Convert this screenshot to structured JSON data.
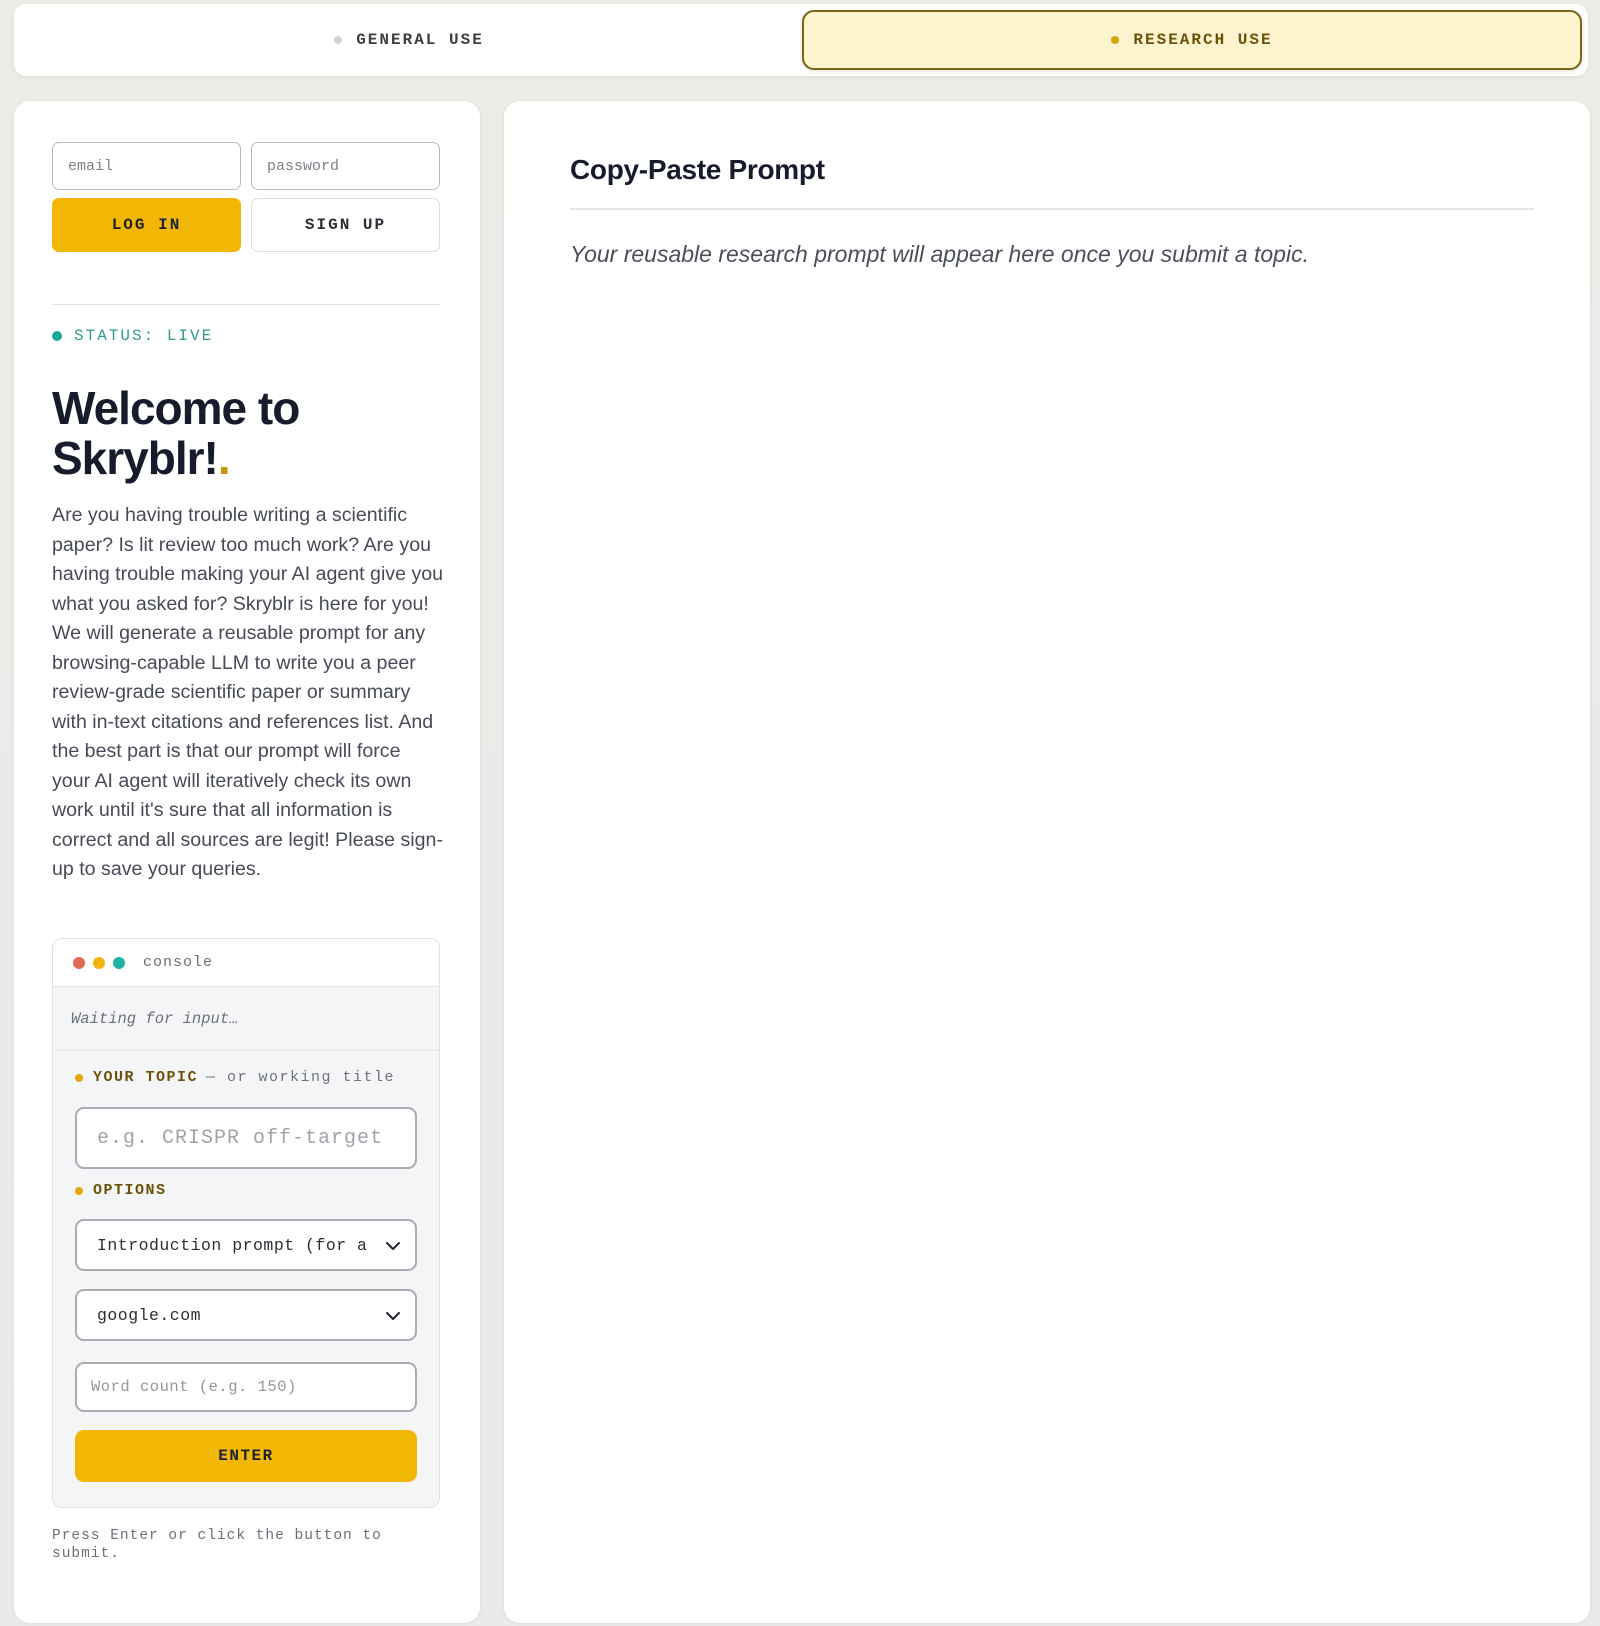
{
  "mode_tabs": {
    "general": {
      "label": "GENERAL USE",
      "active": false
    },
    "research": {
      "label": "RESEARCH USE",
      "active": true
    }
  },
  "auth": {
    "email_placeholder": "email",
    "password_placeholder": "password",
    "login_label": "LOG IN",
    "signup_label": "SIGN UP"
  },
  "status": {
    "label": "STATUS: LIVE",
    "color": "#19a999"
  },
  "welcome": {
    "line1": "Welcome to",
    "brand": "Skryblr!",
    "accent": "."
  },
  "intro_text": "Are you having trouble writing a scientific paper? Is lit review too much work? Are you having trouble making your AI agent give you what you asked for? Skryblr is here for you! We will generate a reusable prompt for any browsing-capable LLM to write you a peer review-grade scientific paper or summary with in-text citations and references list. And the best part is that our prompt will force your AI agent will iteratively check its own work until it's sure that all information is correct and all sources are legit! Please sign-up to save your queries.",
  "console": {
    "title": "console",
    "status_text": "Waiting for input…",
    "topic_label": "YOUR TOPIC",
    "topic_sublabel": "— or working title",
    "topic_placeholder": "e.g. CRISPR off-target",
    "options_label": "OPTIONS",
    "prompt_type_value": "Introduction prompt (for a",
    "search_engine_value": "google.com",
    "word_count_placeholder": "Word count (e.g. 150)",
    "enter_label": "ENTER"
  },
  "hint": "Press Enter or click the button to submit.",
  "output": {
    "title": "Copy-Paste Prompt",
    "placeholder": "Your reusable research prompt will appear here once you submit a topic."
  },
  "colors": {
    "accent": "#f2b704",
    "accent_dark": "#6b5208",
    "status_green": "#19a999"
  }
}
